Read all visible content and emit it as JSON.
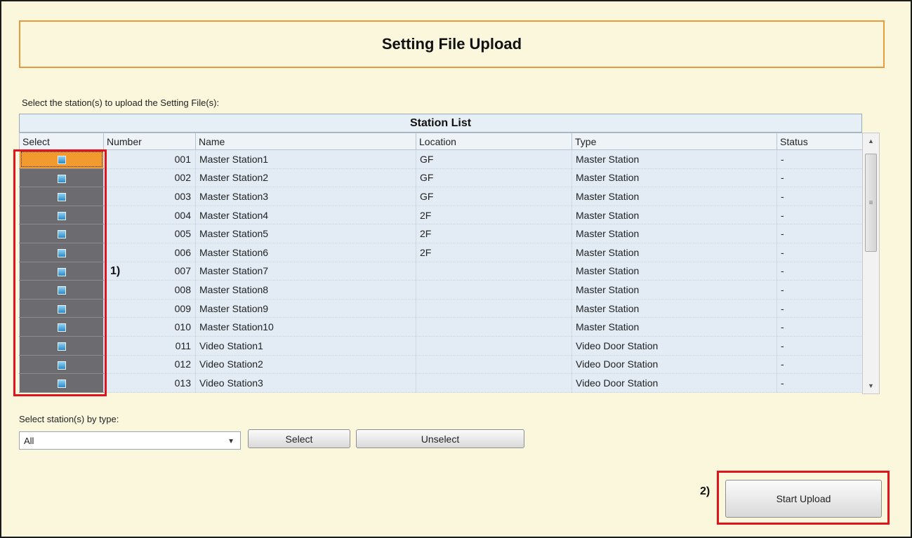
{
  "title": "Setting File Upload",
  "instruction": "Select the station(s) to upload the Setting File(s):",
  "station_list": {
    "title": "Station List",
    "columns": [
      "Select",
      "Number",
      "Name",
      "Location",
      "Type",
      "Status"
    ],
    "rows": [
      {
        "number": "001",
        "name": "Master Station1",
        "location": "GF",
        "type": "Master Station",
        "status": "-"
      },
      {
        "number": "002",
        "name": "Master Station2",
        "location": "GF",
        "type": "Master Station",
        "status": "-"
      },
      {
        "number": "003",
        "name": "Master Station3",
        "location": "GF",
        "type": "Master Station",
        "status": "-"
      },
      {
        "number": "004",
        "name": "Master Station4",
        "location": "2F",
        "type": "Master Station",
        "status": "-"
      },
      {
        "number": "005",
        "name": "Master Station5",
        "location": "2F",
        "type": "Master Station",
        "status": "-"
      },
      {
        "number": "006",
        "name": "Master Station6",
        "location": "2F",
        "type": "Master Station",
        "status": "-"
      },
      {
        "number": "007",
        "name": "Master Station7",
        "location": "",
        "type": "Master Station",
        "status": "-"
      },
      {
        "number": "008",
        "name": "Master Station8",
        "location": "",
        "type": "Master Station",
        "status": "-"
      },
      {
        "number": "009",
        "name": "Master Station9",
        "location": "",
        "type": "Master Station",
        "status": "-"
      },
      {
        "number": "010",
        "name": "Master Station10",
        "location": "",
        "type": "Master Station",
        "status": "-"
      },
      {
        "number": "011",
        "name": "Video Station1",
        "location": "",
        "type": "Video Door Station",
        "status": "-"
      },
      {
        "number": "012",
        "name": "Video Station2",
        "location": "",
        "type": "Video Door Station",
        "status": "-"
      },
      {
        "number": "013",
        "name": "Video Station3",
        "location": "",
        "type": "Video Door Station",
        "status": "-"
      }
    ]
  },
  "select_by_type": {
    "label": "Select station(s) by type:",
    "value": "All"
  },
  "buttons": {
    "select": "Select",
    "unselect": "Unselect",
    "start_upload": "Start Upload"
  },
  "annotations": {
    "one": "1)",
    "two": "2)"
  },
  "colors": {
    "background": "#fbf7dc",
    "title_border": "#e99a3c",
    "highlight": "#e0141c",
    "selected_cell": "#f39a2e"
  }
}
